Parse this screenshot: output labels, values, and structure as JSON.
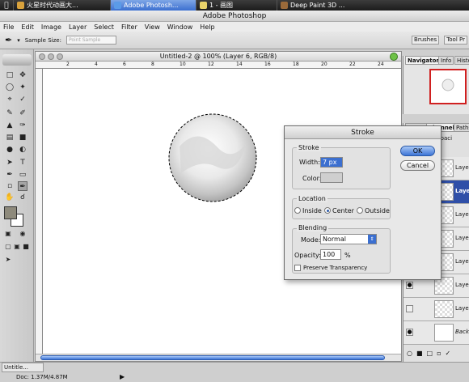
{
  "taskbar": {
    "tabs": [
      {
        "label": "火星时代动画大..."
      },
      {
        "label": "Adobe Photosh..."
      },
      {
        "label": "1 - 画图"
      },
      {
        "label": "Deep Paint 3D ..."
      }
    ]
  },
  "window": {
    "title": "Adobe Photoshop"
  },
  "menu": {
    "items": [
      "File",
      "Edit",
      "Image",
      "Layer",
      "Select",
      "Filter",
      "View",
      "Window",
      "Help"
    ]
  },
  "options": {
    "sample_size_label": "Sample Size:",
    "sample_size_value": "Point Sample",
    "brushes": "Brushes",
    "tool_presets": "Tool Pr"
  },
  "document": {
    "title": "Untitled-2 @ 100% (Layer 6, RGB/8)",
    "ruler_ticks": [
      "2",
      "4",
      "6",
      "8",
      "10",
      "12",
      "14",
      "16",
      "18",
      "20",
      "22",
      "24"
    ]
  },
  "status": {
    "doc_info": "Doc: 1.37M/4.87M",
    "taskbar_item": "Untitle..."
  },
  "navigator": {
    "tabs": [
      "Navigator",
      "Info",
      "Histo"
    ]
  },
  "layers": {
    "tabs": [
      "Layers",
      "Channels",
      "Paths"
    ],
    "opacity_label": "Opaci",
    "rows": [
      {
        "name": "Layer",
        "selected": false
      },
      {
        "name": "Layer",
        "selected": true
      },
      {
        "name": "Layer",
        "selected": false
      },
      {
        "name": "Layer",
        "selected": false
      },
      {
        "name": "Layer",
        "selected": false
      },
      {
        "name": "Layer",
        "selected": false
      },
      {
        "name": "Layer",
        "selected": false
      },
      {
        "name": "Backgr",
        "selected": false
      }
    ]
  },
  "dialog": {
    "title": "Stroke",
    "stroke": {
      "group": "Stroke",
      "width_label": "Width:",
      "width_value": "7 px",
      "color_label": "Color:"
    },
    "location": {
      "group": "Location",
      "inside": "Inside",
      "center": "Center",
      "outside": "Outside",
      "selected": "Center"
    },
    "blending": {
      "group": "Blending",
      "mode_label": "Mode:",
      "mode_value": "Normal",
      "opacity_label": "Opacity:",
      "opacity_value": "100",
      "opacity_unit": "%",
      "preserve_label": "Preserve Transparency"
    },
    "ok": "OK",
    "cancel": "Cancel"
  },
  "colors": {
    "foreground": "#8e8a7c",
    "background": "#ffffff",
    "accent": "#3b6fd0"
  }
}
